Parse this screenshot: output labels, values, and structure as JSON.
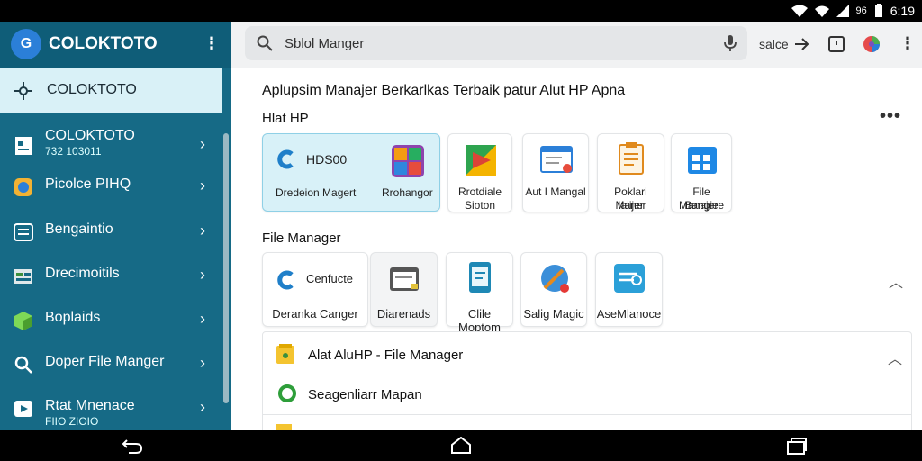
{
  "status_bar": {
    "time": "6:19",
    "battery": "96"
  },
  "sidebar": {
    "app_title": "COLOKTOTO",
    "active_item": "COLOKTOTO",
    "items": [
      {
        "label": "COLOKTOTO",
        "sub": "732 103011"
      },
      {
        "label": "Picolce PIHQ",
        "sub": ""
      },
      {
        "label": "Bengaintio",
        "sub": ""
      },
      {
        "label": "Drecimoitils",
        "sub": ""
      },
      {
        "label": "Boplaids",
        "sub": ""
      },
      {
        "label": "Doper File Manger",
        "sub": ""
      },
      {
        "label": "Rtat Mnenace",
        "sub": "FIIO ZIOIO"
      }
    ]
  },
  "topbar": {
    "search_text": "Sblol Manger",
    "right_text": "salce"
  },
  "content": {
    "heading": "Aplupsim Manajer Berkarlkas Terbaik patur Alut HP Apna",
    "section1": {
      "label": "Hlat HP",
      "featured": {
        "title": "HDS00",
        "left_label": "Dredeion Magert",
        "right_label": "Rrohangor"
      },
      "cards": [
        {
          "line1": "Rrotdiale",
          "line2": "Sioton"
        },
        {
          "line1": "Aut I Mangal",
          "line2": ""
        },
        {
          "line1": "Poklari Maner",
          "line2": "Iaiijer"
        },
        {
          "line1": "File Manajere",
          "line2": "Bangie"
        }
      ]
    },
    "section2": {
      "label": "File Manager",
      "cards": [
        {
          "title": "Cenfucte",
          "label": "Deranka Canger"
        },
        {
          "title": "",
          "label": "Diarenads"
        },
        {
          "title": "",
          "label": "Clile Moptom"
        },
        {
          "title": "",
          "label": "Salig Magic"
        },
        {
          "title": "",
          "label": "AseMlanoce"
        }
      ]
    },
    "section3": {
      "title": "Alat AluHP - File Manager",
      "item": "Seagenliarr Mapan"
    }
  },
  "colors": {
    "sidebar_bg": "#166a86",
    "sidebar_active": "#d9f1f7",
    "card_highlight": "#d8f1f8"
  }
}
